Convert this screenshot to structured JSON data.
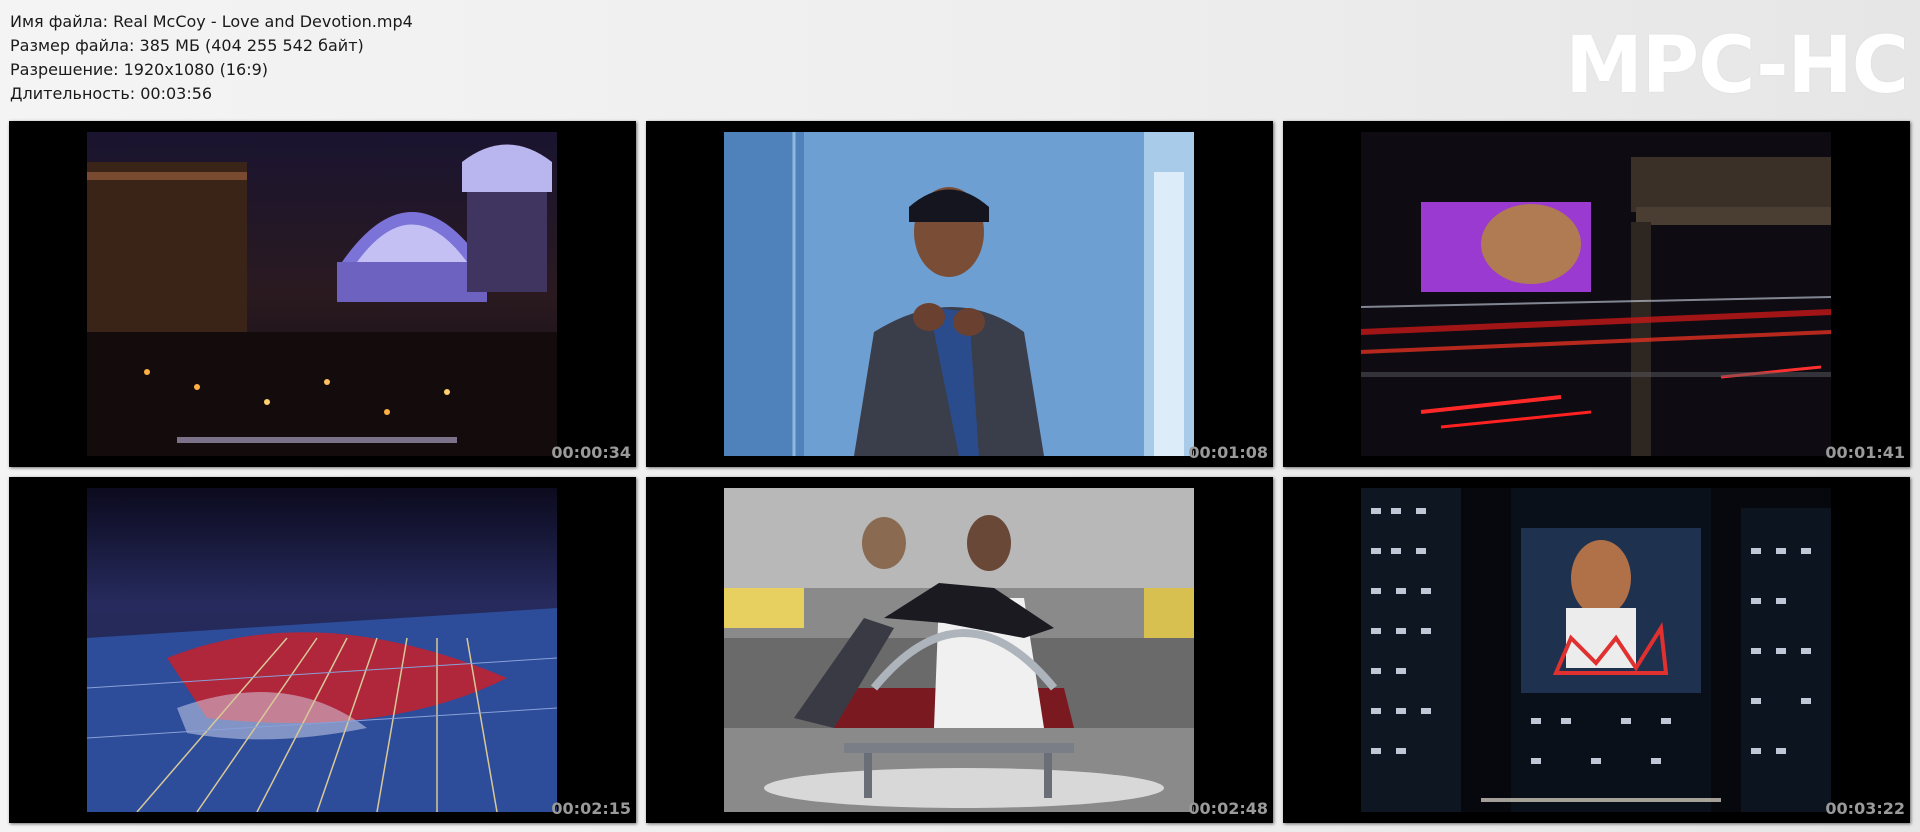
{
  "info": {
    "filename": "Имя файла: Real McCoy - Love and Devotion.mp4",
    "filesize": "Размер файла: 385 МБ (404 255 542 байт)",
    "resolution": "Разрешение: 1920x1080 (16:9)",
    "duration": "Длительность: 00:03:56"
  },
  "logo": "MPC-HC",
  "thumbnails": [
    {
      "timestamp": "00:00:34",
      "scene": "night-cityscape"
    },
    {
      "timestamp": "00:01:08",
      "scene": "woman-blue-wall"
    },
    {
      "timestamp": "00:01:41",
      "scene": "billboard-light-trails"
    },
    {
      "timestamp": "00:02:15",
      "scene": "neon-building-facade"
    },
    {
      "timestamp": "00:02:48",
      "scene": "couple-on-bench"
    },
    {
      "timestamp": "00:03:22",
      "scene": "skyscrapers-billboard"
    }
  ]
}
